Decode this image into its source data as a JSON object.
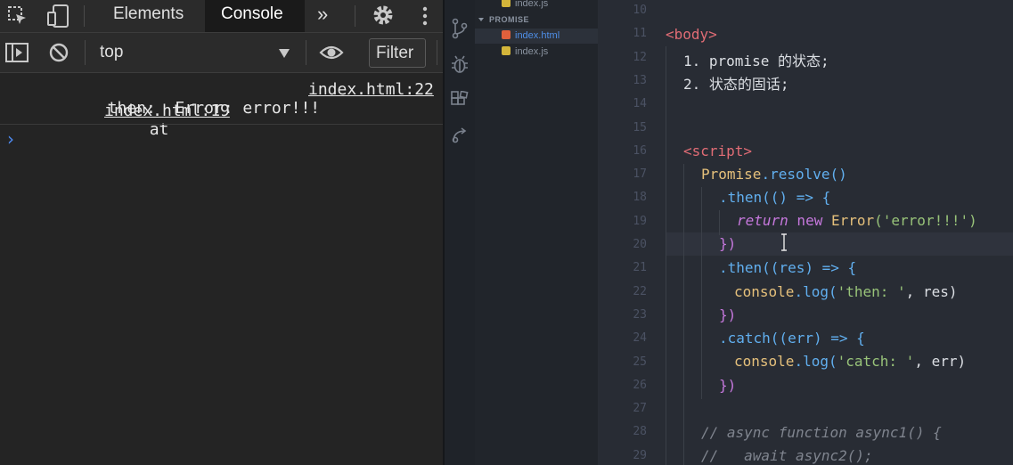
{
  "devtools": {
    "tabs": {
      "elements": "Elements",
      "console": "Console",
      "more": "»"
    },
    "toolbar": {
      "context": "top",
      "filter": "Filter"
    },
    "messages": [
      {
        "text": "then:  Error: error!!!",
        "source": "index.html:22"
      },
      {
        "text": "at",
        "source": "index.html:19"
      }
    ],
    "prompt": "›"
  },
  "explorer": {
    "section": "PROMISE",
    "files_top": "index.js",
    "files": [
      {
        "name": "index.html",
        "active": true
      },
      {
        "name": "index.js",
        "active": false
      }
    ]
  },
  "editor": {
    "line_numbers": [
      "10",
      "11",
      "12",
      "13",
      "14",
      "15",
      "16",
      "17",
      "18",
      "19",
      "20",
      "21",
      "22",
      "23",
      "24",
      "25",
      "26",
      "27",
      "28",
      "29"
    ],
    "lines": {
      "l11": "<body>",
      "l12": "1. promise 的状态;",
      "l13": "2. 状态的固话;",
      "l16": "<script>",
      "l17a": "Promise",
      "l17b": ".resolve()",
      "l18": ".then(() => {",
      "l19a": "return",
      "l19b": " new ",
      "l19c": "Error",
      "l19d": "('error!!!')",
      "l20": "})",
      "l21": ".then((res) => {",
      "l22a": "console",
      "l22b": ".log(",
      "l22c": "'then: '",
      "l22d": ", res)",
      "l23": "})",
      "l24": ".catch((err) => {",
      "l25a": "console",
      "l25b": ".log(",
      "l25c": "'catch: '",
      "l25d": ", err)",
      "l26": "})",
      "l28": "// async function async1() {",
      "l29": "//   await async2();"
    }
  }
}
